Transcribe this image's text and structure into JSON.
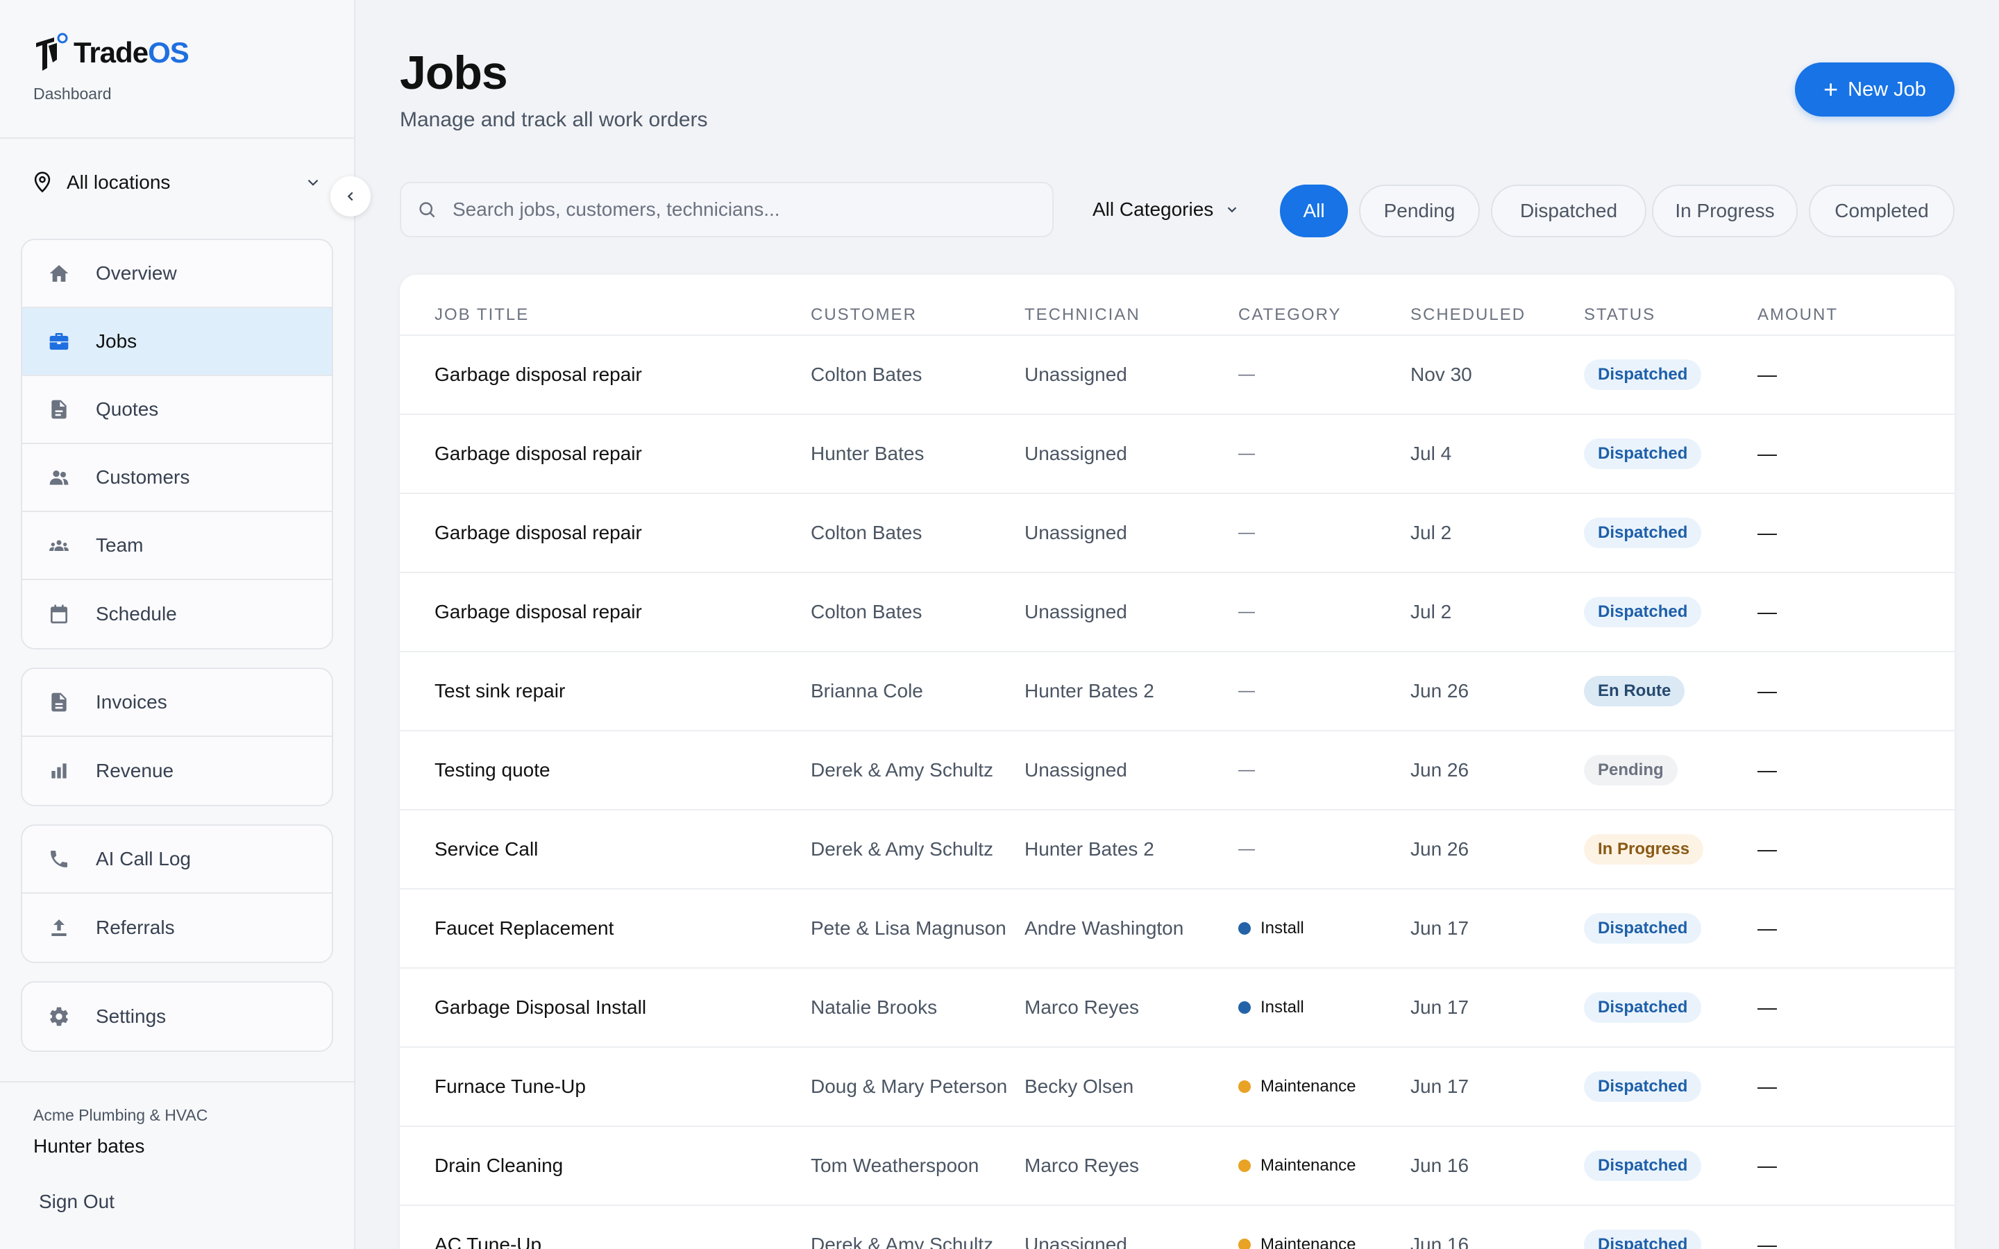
{
  "app": {
    "brand_prefix": "Trade",
    "brand_suffix": "OS",
    "subtitle": "Dashboard"
  },
  "sidebar": {
    "location": "All locations",
    "groups": [
      [
        {
          "label": "Overview",
          "icon": "home-icon",
          "active": false
        },
        {
          "label": "Jobs",
          "icon": "briefcase-icon",
          "active": true
        },
        {
          "label": "Quotes",
          "icon": "document-icon",
          "active": false
        },
        {
          "label": "Customers",
          "icon": "people-icon",
          "active": false
        },
        {
          "label": "Team",
          "icon": "team-icon",
          "active": false
        },
        {
          "label": "Schedule",
          "icon": "calendar-icon",
          "active": false
        }
      ],
      [
        {
          "label": "Invoices",
          "icon": "invoice-icon",
          "active": false
        },
        {
          "label": "Revenue",
          "icon": "bar-chart-icon",
          "active": false
        }
      ],
      [
        {
          "label": "AI Call Log",
          "icon": "phone-icon",
          "active": false
        },
        {
          "label": "Referrals",
          "icon": "upload-icon",
          "active": false
        }
      ],
      [
        {
          "label": "Settings",
          "icon": "gear-icon",
          "active": false
        }
      ]
    ],
    "company": "Acme Plumbing & HVAC",
    "user": "Hunter bates",
    "sign_out": "Sign Out"
  },
  "header": {
    "title": "Jobs",
    "subtitle": "Manage and track all work orders",
    "new_job_label": "New Job"
  },
  "filters": {
    "search_placeholder": "Search jobs, customers, technicians...",
    "category": "All Categories",
    "status_pills": [
      {
        "label": "All",
        "active": true
      },
      {
        "label": "Pending",
        "active": false
      },
      {
        "label": "Dispatched",
        "active": false
      },
      {
        "label": "In Progress",
        "active": false
      },
      {
        "label": "Completed",
        "active": false
      }
    ]
  },
  "table": {
    "columns": [
      "JOB TITLE",
      "CUSTOMER",
      "TECHNICIAN",
      "CATEGORY",
      "SCHEDULED",
      "STATUS",
      "AMOUNT"
    ],
    "rows": [
      {
        "title": "Garbage disposal repair",
        "customer": "Colton Bates",
        "technician": "Unassigned",
        "category": "—",
        "category_color": "",
        "scheduled": "Nov 30",
        "status": "Dispatched",
        "status_kind": "dispatched",
        "amount": "—"
      },
      {
        "title": "Garbage disposal repair",
        "customer": "Hunter Bates",
        "technician": "Unassigned",
        "category": "—",
        "category_color": "",
        "scheduled": "Jul 4",
        "status": "Dispatched",
        "status_kind": "dispatched",
        "amount": "—"
      },
      {
        "title": "Garbage disposal repair",
        "customer": "Colton Bates",
        "technician": "Unassigned",
        "category": "—",
        "category_color": "",
        "scheduled": "Jul 2",
        "status": "Dispatched",
        "status_kind": "dispatched",
        "amount": "—"
      },
      {
        "title": "Garbage disposal repair",
        "customer": "Colton Bates",
        "technician": "Unassigned",
        "category": "—",
        "category_color": "",
        "scheduled": "Jul 2",
        "status": "Dispatched",
        "status_kind": "dispatched",
        "amount": "—"
      },
      {
        "title": "Test sink repair",
        "customer": "Brianna Cole",
        "technician": "Hunter Bates 2",
        "category": "—",
        "category_color": "",
        "scheduled": "Jun 26",
        "status": "En Route",
        "status_kind": "enroute",
        "amount": "—"
      },
      {
        "title": "Testing quote",
        "customer": "Derek & Amy Schultz",
        "technician": "Unassigned",
        "category": "—",
        "category_color": "",
        "scheduled": "Jun 26",
        "status": "Pending",
        "status_kind": "pending",
        "amount": "—"
      },
      {
        "title": "Service Call",
        "customer": "Derek & Amy Schultz",
        "technician": "Hunter Bates 2",
        "category": "—",
        "category_color": "",
        "scheduled": "Jun 26",
        "status": "In Progress",
        "status_kind": "inprogress",
        "amount": "—"
      },
      {
        "title": "Faucet Replacement",
        "customer": "Pete & Lisa Magnuson",
        "technician": "Andre Washington",
        "category": "Install",
        "category_color": "#2563a8",
        "scheduled": "Jun 17",
        "status": "Dispatched",
        "status_kind": "dispatched",
        "amount": "—"
      },
      {
        "title": "Garbage Disposal Install",
        "customer": "Natalie Brooks",
        "technician": "Marco Reyes",
        "category": "Install",
        "category_color": "#2563a8",
        "scheduled": "Jun 17",
        "status": "Dispatched",
        "status_kind": "dispatched",
        "amount": "—"
      },
      {
        "title": "Furnace Tune-Up",
        "customer": "Doug & Mary Peterson",
        "technician": "Becky Olsen",
        "category": "Maintenance",
        "category_color": "#e8a224",
        "scheduled": "Jun 17",
        "status": "Dispatched",
        "status_kind": "dispatched",
        "amount": "—"
      },
      {
        "title": "Drain Cleaning",
        "customer": "Tom Weatherspoon",
        "technician": "Marco Reyes",
        "category": "Maintenance",
        "category_color": "#e8a224",
        "scheduled": "Jun 16",
        "status": "Dispatched",
        "status_kind": "dispatched",
        "amount": "—"
      },
      {
        "title": "AC Tune-Up",
        "customer": "Derek & Amy Schultz",
        "technician": "Unassigned",
        "category": "Maintenance",
        "category_color": "#e8a224",
        "scheduled": "Jun 16",
        "status": "Dispatched",
        "status_kind": "dispatched",
        "amount": "—"
      }
    ]
  }
}
